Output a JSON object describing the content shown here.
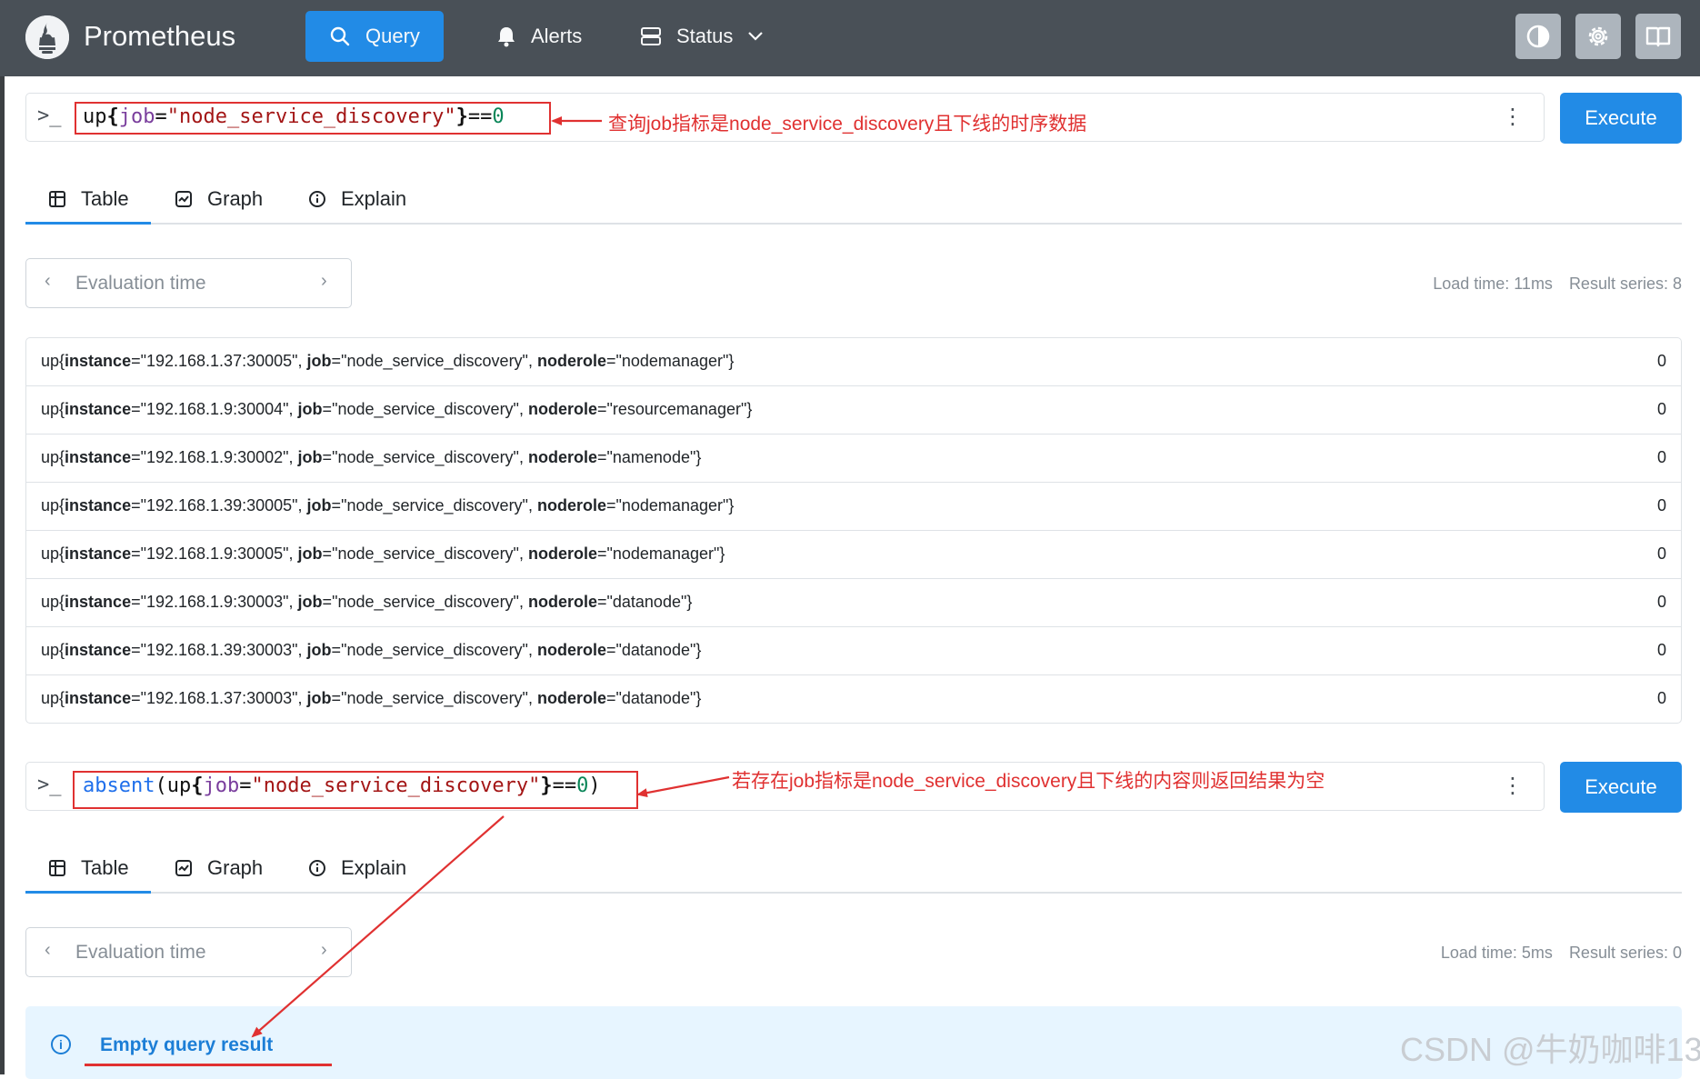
{
  "nav": {
    "brand": "Prometheus",
    "query": "Query",
    "alerts": "Alerts",
    "status": "Status"
  },
  "query1": {
    "prompt": ">_",
    "expr_tokens": [
      "up",
      "{",
      "job",
      "=",
      "\"node_service_discovery\"",
      "}",
      "==",
      "0"
    ],
    "annotation": "查询job指标是node_service_discovery且下线的时序数据",
    "execute": "Execute",
    "tabs": [
      "Table",
      "Graph",
      "Explain"
    ],
    "eval_placeholder": "Evaluation time",
    "load_time": "Load time: 11ms",
    "result_series": "Result series: 8",
    "rows": [
      {
        "instance": "\"192.168.1.37:30005\"",
        "job": "\"node_service_discovery\"",
        "noderole": "\"nodemanager\"",
        "value": "0"
      },
      {
        "instance": "\"192.168.1.9:30004\"",
        "job": "\"node_service_discovery\"",
        "noderole": "\"resourcemanager\"",
        "value": "0"
      },
      {
        "instance": "\"192.168.1.9:30002\"",
        "job": "\"node_service_discovery\"",
        "noderole": "\"namenode\"",
        "value": "0"
      },
      {
        "instance": "\"192.168.1.39:30005\"",
        "job": "\"node_service_discovery\"",
        "noderole": "\"nodemanager\"",
        "value": "0"
      },
      {
        "instance": "\"192.168.1.9:30005\"",
        "job": "\"node_service_discovery\"",
        "noderole": "\"nodemanager\"",
        "value": "0"
      },
      {
        "instance": "\"192.168.1.9:30003\"",
        "job": "\"node_service_discovery\"",
        "noderole": "\"datanode\"",
        "value": "0"
      },
      {
        "instance": "\"192.168.1.39:30003\"",
        "job": "\"node_service_discovery\"",
        "noderole": "\"datanode\"",
        "value": "0"
      },
      {
        "instance": "\"192.168.1.37:30003\"",
        "job": "\"node_service_discovery\"",
        "noderole": "\"datanode\"",
        "value": "0"
      }
    ]
  },
  "query2": {
    "prompt": ">_",
    "expr_tokens": [
      "absent",
      "(",
      "up",
      "{",
      "job",
      "=",
      "\"node_service_discovery\"",
      "}",
      "==",
      "0",
      ")"
    ],
    "annotation": "若存在job指标是node_service_discovery且下线的内容则返回结果为空",
    "execute": "Execute",
    "tabs": [
      "Table",
      "Graph",
      "Explain"
    ],
    "eval_placeholder": "Evaluation time",
    "load_time": "Load time: 5ms",
    "result_series": "Result series: 0",
    "empty_message": "Empty query result"
  },
  "row_labels": {
    "prefix": "up{",
    "instance": "instance",
    "job": "job",
    "noderole": "noderole",
    "eq": "=",
    "sep": ", ",
    "close": "}"
  },
  "watermark": "CSDN @牛奶咖啡13",
  "colors": {
    "navbar": "#495057",
    "accent": "#228be6",
    "annotation": "#e03131"
  }
}
